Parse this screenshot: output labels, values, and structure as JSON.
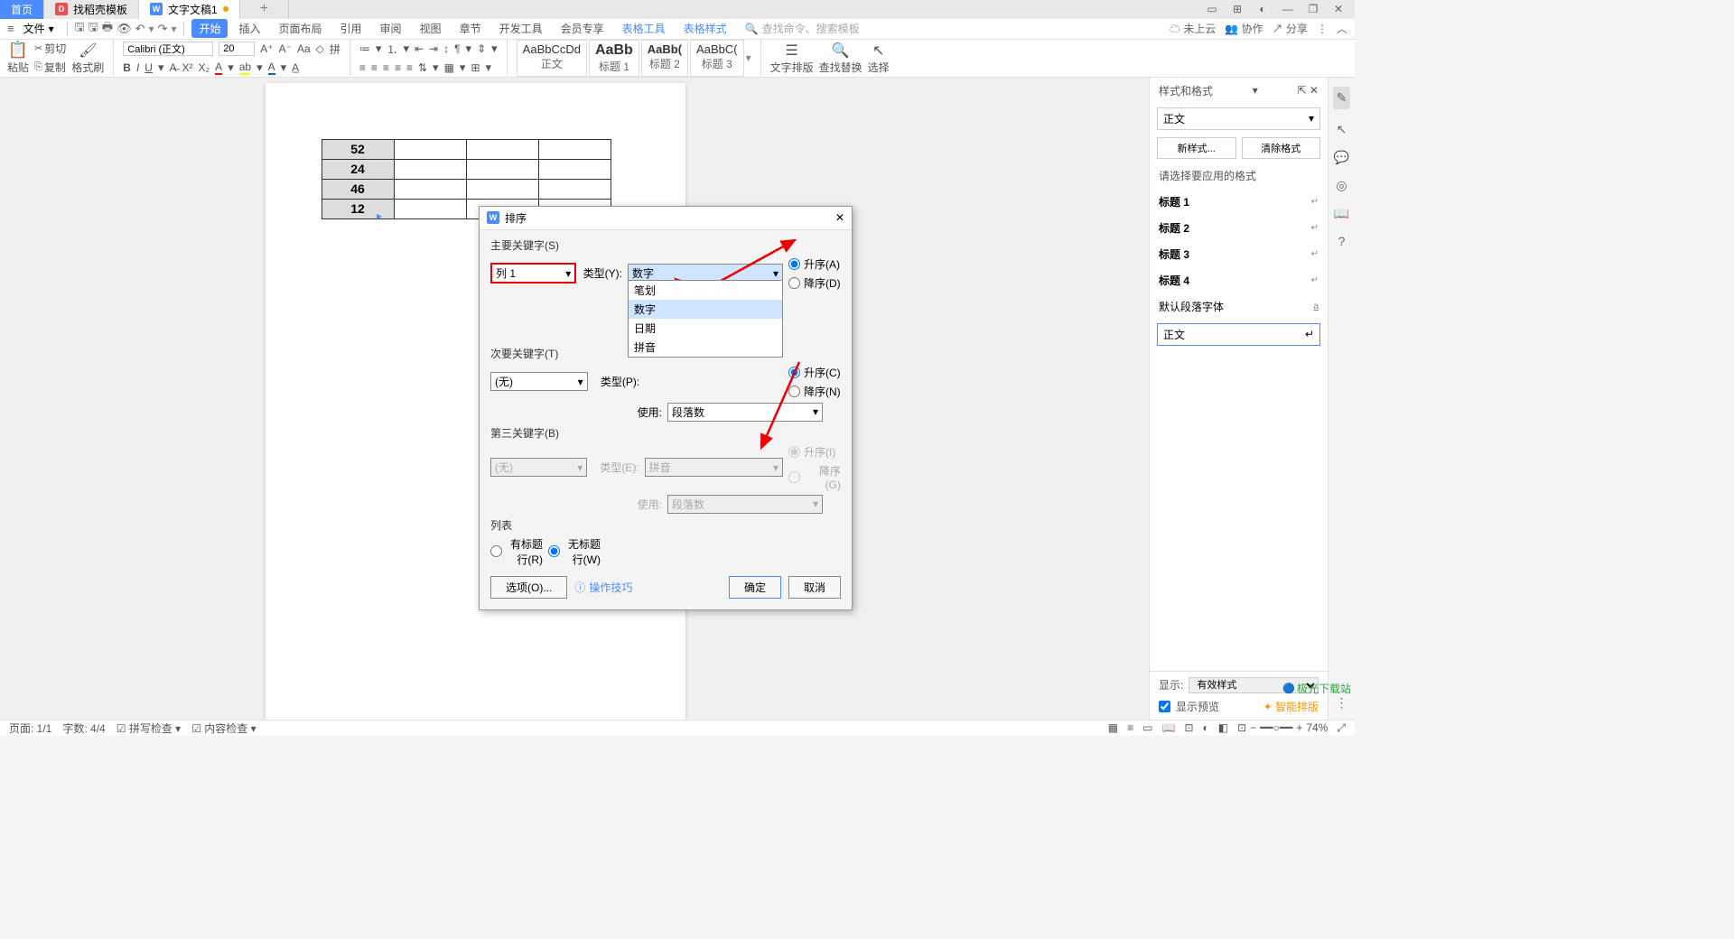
{
  "tabs": {
    "home": "首页",
    "tpl": "找稻壳模板",
    "doc": "文字文稿1"
  },
  "menubar": {
    "file": "文件",
    "items": [
      "开始",
      "插入",
      "页面布局",
      "引用",
      "审阅",
      "视图",
      "章节",
      "开发工具",
      "会员专享",
      "表格工具",
      "表格样式"
    ],
    "search_placeholder": "查找命令、搜索模板",
    "right": {
      "cloud": "未上云",
      "collab": "协作",
      "share": "分享"
    }
  },
  "ribbon": {
    "paste": "粘贴",
    "cut": "剪切",
    "copy": "复制",
    "fmt": "格式刷",
    "font": "Calibri (正文)",
    "size": "20",
    "styles": [
      {
        "preview": "AaBbCcDd",
        "name": "正文"
      },
      {
        "preview": "AaBb",
        "name": "标题 1"
      },
      {
        "preview": "AaBb(",
        "name": "标题 2"
      },
      {
        "preview": "AaBbC(",
        "name": "标题 3"
      }
    ],
    "right": {
      "textlayout": "文字排版",
      "find": "查找替换",
      "select": "选择"
    }
  },
  "table_data": [
    "52",
    "24",
    "46",
    "12"
  ],
  "dialog": {
    "title": "排序",
    "sec1": "主要关键字(S)",
    "sec2": "次要关键字(T)",
    "sec3": "第三关键字(B)",
    "sec4": "列表",
    "col1": "列 1",
    "none": "(无)",
    "type_lbl_y": "类型(Y):",
    "type_lbl_p": "类型(P):",
    "type_lbl_e": "类型(E):",
    "use_lbl": "使用:",
    "type_val": "数字",
    "pinyin": "拼音",
    "paranum": "段落数",
    "dd_options": [
      "笔划",
      "数字",
      "日期",
      "拼音"
    ],
    "asc_a": "升序(A)",
    "desc_d": "降序(D)",
    "asc_c": "升序(C)",
    "desc_n": "降序(N)",
    "asc_i": "升序(I)",
    "desc_g": "降序(G)",
    "has_header": "有标题行(R)",
    "no_header": "无标题行(W)",
    "options": "选项(O)...",
    "tip": "操作技巧",
    "ok": "确定",
    "cancel": "取消"
  },
  "side": {
    "title": "样式和格式",
    "current": "正文",
    "new": "新样式...",
    "clear": "清除格式",
    "apply_label": "请选择要应用的格式",
    "styles": [
      "标题 1",
      "标题 2",
      "标题 3",
      "标题 4"
    ],
    "default_para": "默认段落字体",
    "body": "正文",
    "show": "显示:",
    "show_val": "有效样式",
    "preview": "显示预览",
    "smart": "智能排版"
  },
  "status": {
    "page": "页面: 1/1",
    "words": "字数: 4/4",
    "spell": "拼写检查",
    "content": "内容检查",
    "zoom": "74%"
  },
  "watermark": "极光下载站"
}
